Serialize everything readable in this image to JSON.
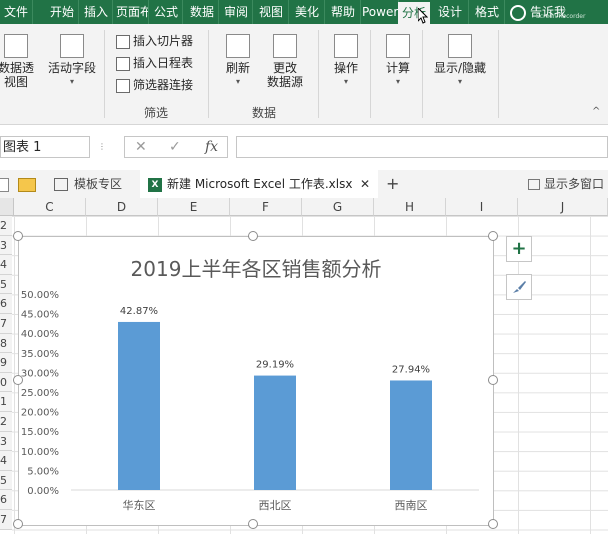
{
  "ribbon_tabs": [
    "文件",
    "开始",
    "插入",
    "页面布局",
    "公式",
    "数据",
    "审阅",
    "视图",
    "美化",
    "帮助",
    "Power Pivot",
    "分析",
    "设计",
    "格式"
  ],
  "active_tab": "分析",
  "tell_me": "告诉我",
  "watermark": "Screen Recorder",
  "ribbon": {
    "pivot_table": "数据透视图",
    "active_field": "活动字段",
    "insert_slicer": "插入切片器",
    "insert_timeline": "插入日程表",
    "filter_connections": "筛选器连接",
    "filter_group": "筛选",
    "refresh": "刷新",
    "change_source_1": "更改",
    "change_source_2": "数据源",
    "data_group": "数据",
    "actions": "操作",
    "calculations": "计算",
    "show_hide": "显示/隐藏"
  },
  "formula_bar": {
    "name_box": "图表 1",
    "fx": "fx"
  },
  "workbook_tabs": {
    "templates": "模板专区",
    "file": "新建 Microsoft Excel 工作表.xlsx",
    "new_tab": "+",
    "multi_window": "显示多窗口"
  },
  "columns": [
    "C",
    "D",
    "E",
    "F",
    "G",
    "H",
    "I",
    "J"
  ],
  "rows": [
    "2",
    "3",
    "4",
    "5",
    "6",
    "7",
    "8",
    "9",
    "0",
    "1",
    "2",
    "3",
    "4",
    "5",
    "6",
    "7"
  ],
  "colors": {
    "ribbon_green": "#217346",
    "bar_blue": "#5b9bd5"
  },
  "chart_data": {
    "type": "bar",
    "title": "2019上半年各区销售额分析",
    "categories": [
      "华东区",
      "西北区",
      "西南区"
    ],
    "values": [
      0.4287,
      0.2919,
      0.2794
    ],
    "data_labels": [
      "42.87%",
      "29.19%",
      "27.94%"
    ],
    "ytick_labels": [
      "0.00%",
      "5.00%",
      "10.00%",
      "15.00%",
      "20.00%",
      "25.00%",
      "30.00%",
      "35.00%",
      "40.00%",
      "45.00%",
      "50.00%"
    ],
    "ylim": [
      0,
      0.5
    ],
    "grid": false,
    "legend": "none"
  }
}
